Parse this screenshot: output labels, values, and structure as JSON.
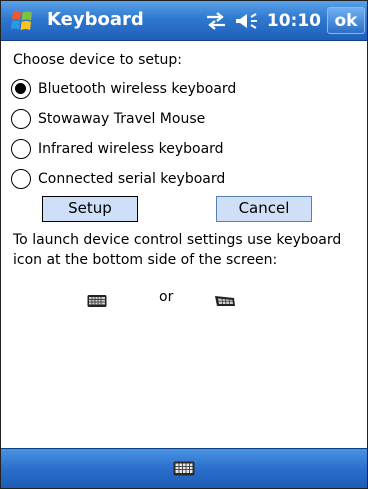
{
  "titlebar": {
    "title": "Keyboard",
    "time": "10:10",
    "ok_label": "ok",
    "icons": [
      "windows-start-icon",
      "connectivity-icon",
      "volume-icon"
    ]
  },
  "content": {
    "prompt": "Choose device to setup:",
    "options": [
      {
        "label": "Bluetooth wireless keyboard",
        "checked": true
      },
      {
        "label": "Stowaway Travel Mouse",
        "checked": false
      },
      {
        "label": "Infrared wireless keyboard",
        "checked": false
      },
      {
        "label": "Connected serial keyboard",
        "checked": false
      }
    ],
    "setup_label": "Setup",
    "cancel_label": "Cancel",
    "info_text": "To launch device control settings use keyboard icon at the bottom side of the screen:",
    "or_text": "or"
  },
  "bottombar": {
    "icon": "keyboard-icon"
  },
  "colors": {
    "titlebar": "#2f78d0",
    "button_fill": "#cde0f7"
  }
}
